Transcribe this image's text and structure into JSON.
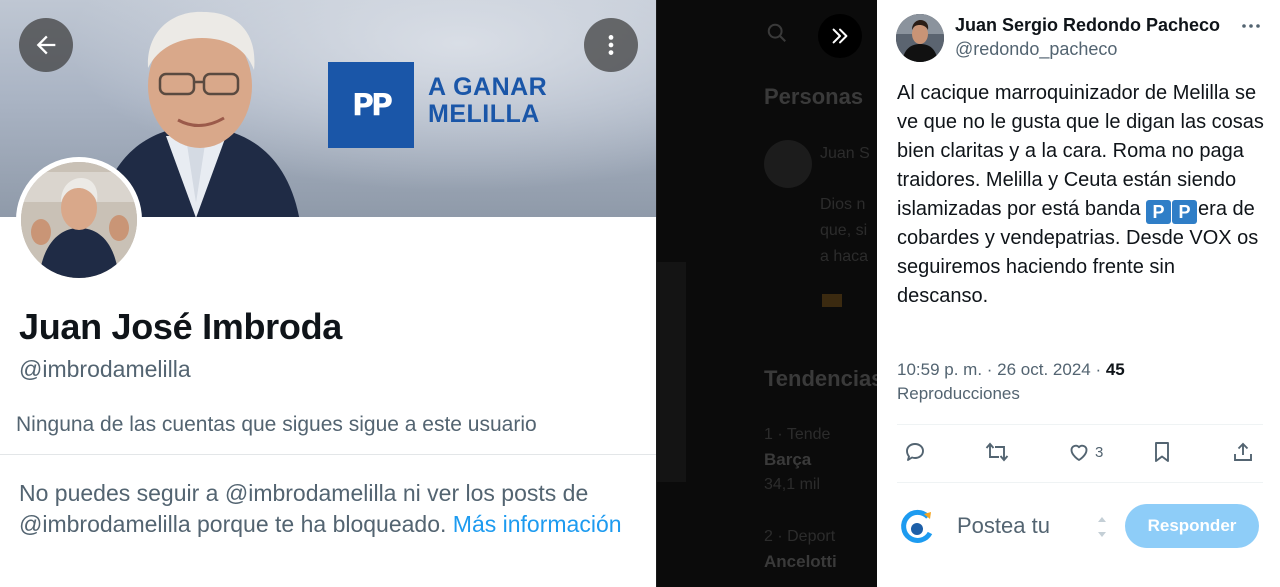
{
  "profile": {
    "banner_logo_text": "PP",
    "banner_slogan_line1": "A GANAR",
    "banner_slogan_line2": "MELILLA",
    "display_name": "Juan José Imbroda",
    "handle": "@imbrodamelilla",
    "follow_note": "Ninguna de las cuentas que sigues sigue a este usuario",
    "blocked_text": "No puedes seguir a @imbrodamelilla ni ver los posts de @imbrodamelilla porque te ha bloqueado.",
    "blocked_more_link": "Más información",
    "back_icon": "arrow-left-icon",
    "more_icon": "vertical-dots-icon"
  },
  "background": {
    "headings": [
      "Personas",
      "Tendencias"
    ],
    "trend_name_1": "Barça",
    "trend_name_2": "Ancelotti"
  },
  "tweet": {
    "author_name": "Juan Sergio Redondo Pacheco",
    "author_handle": "@redondo_pacheco",
    "body_part1": "Al cacique marroquinizador de Melilla se ve que no le gusta que le digan las cosas bien claritas y a la cara. Roma no paga traidores. Melilla y Ceuta están siendo islamizadas por está banda ",
    "emoji_p1": "P",
    "emoji_p2": "P",
    "body_part2": "era de cobardes y vendepatrias. Desde VOX os seguiremos haciendo frente sin descanso.",
    "time": "10:59 p. m. · 26 oct. 2024 · ",
    "views_count": "45",
    "views_label": "Reproducciones",
    "like_count": "3",
    "composer_placeholder": "Postea tu",
    "reply_button": "Responder"
  },
  "colors": {
    "accent": "#1d9bf0",
    "reply_button_disabled": "#8ecdf8",
    "pp_blue": "#1a56a8",
    "secondary_text": "#536471",
    "primary_text": "#0f1419"
  }
}
